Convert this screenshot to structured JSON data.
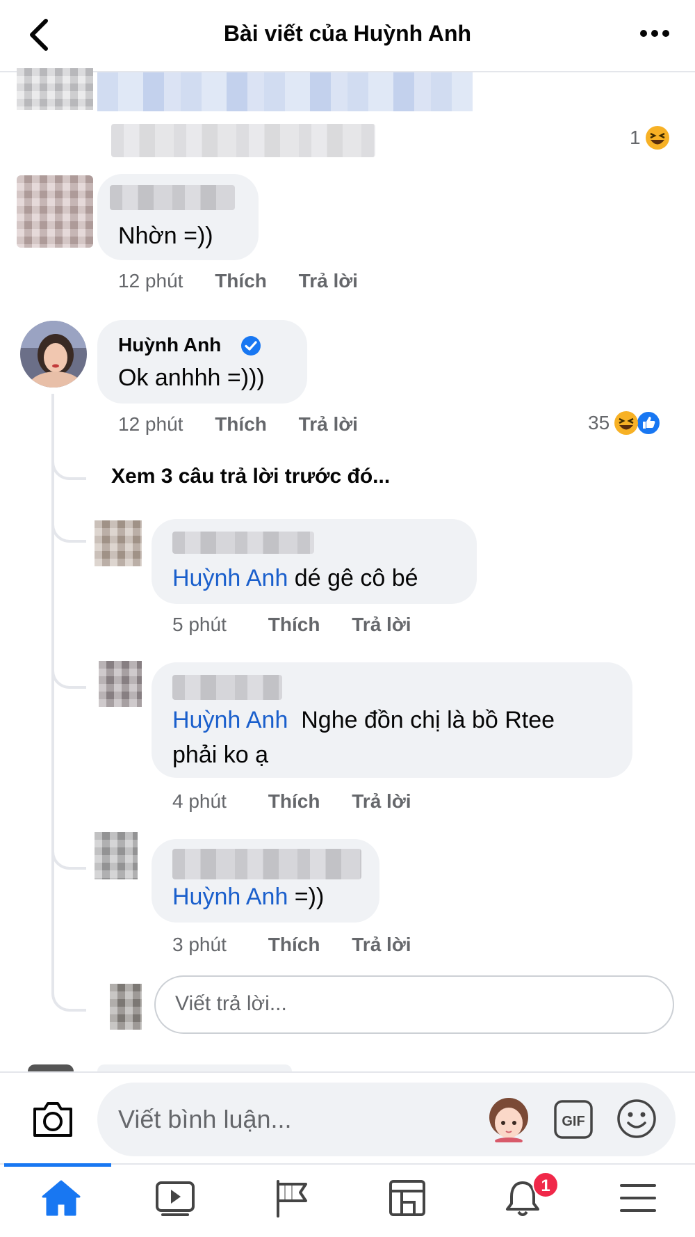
{
  "header": {
    "title": "Bài viết của Huỳnh Anh"
  },
  "comments": [
    {
      "reaction_count": "1",
      "reaction_types": [
        "haha"
      ]
    },
    {
      "text": "Nhờn =))",
      "time": "12 phút",
      "like_label": "Thích",
      "reply_label": "Trả lời"
    },
    {
      "author": "Huỳnh Anh",
      "verified": true,
      "text": "Ok anhhh =)))",
      "time": "12 phút",
      "like_label": "Thích",
      "reply_label": "Trả lời",
      "reaction_count": "35",
      "reaction_types": [
        "haha",
        "like"
      ]
    }
  ],
  "thread": {
    "see_more": "Xem 3 câu trả lời trước đó...",
    "replies": [
      {
        "mention": "Huỳnh Anh",
        "text": " dé gê cô bé",
        "time": "5 phút",
        "like_label": "Thích",
        "reply_label": "Trả lời"
      },
      {
        "mention": "Huỳnh Anh",
        "text_line1": "  Nghe đồn chị là bồ Rtee",
        "text_line2": "phải ko ạ",
        "time": "4 phút",
        "like_label": "Thích",
        "reply_label": "Trả lời"
      },
      {
        "mention": "Huỳnh Anh",
        "text": " =))",
        "time": "3 phút",
        "like_label": "Thích",
        "reply_label": "Trả lời"
      }
    ],
    "reply_placeholder": "Viết trả lời..."
  },
  "composer": {
    "placeholder": "Viết bình luận...",
    "gif_label": "GIF"
  },
  "tabbar": {
    "items": [
      "home-icon",
      "video-icon",
      "pages-flag-icon",
      "marketplace-icon",
      "notifications-icon",
      "menu-icon"
    ],
    "active": "home-icon",
    "notification_badge": "1"
  },
  "colors": {
    "accent": "#1877f2",
    "mention": "#1a5fcc",
    "bubble": "#f0f2f5",
    "meta_text": "#65676b",
    "badge": "#f02849",
    "haha_face": "#f7b125"
  }
}
